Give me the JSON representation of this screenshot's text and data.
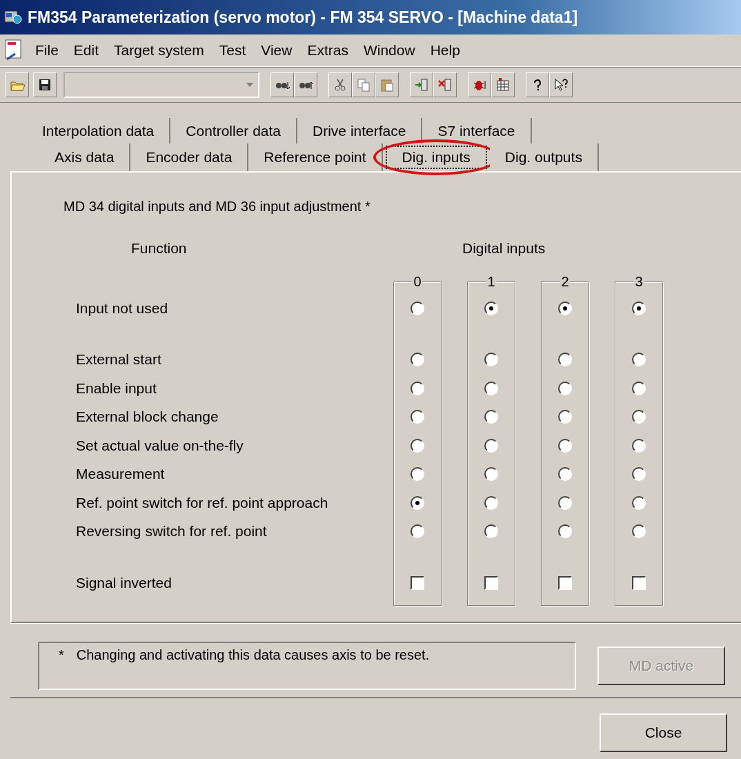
{
  "window": {
    "title": "FM354 Parameterization (servo motor) - FM 354 SERVO - [Machine data1]"
  },
  "menu": [
    "File",
    "Edit",
    "Target system",
    "Test",
    "View",
    "Extras",
    "Window",
    "Help"
  ],
  "tabs_back": [
    {
      "label": "Interpolation data",
      "selected": false
    },
    {
      "label": "Controller data",
      "selected": false
    },
    {
      "label": "Drive interface",
      "selected": false
    },
    {
      "label": "S7 interface",
      "selected": false
    }
  ],
  "tabs_front": [
    {
      "label": "Axis data",
      "selected": false
    },
    {
      "label": "Encoder data",
      "selected": false
    },
    {
      "label": "Reference point",
      "selected": false
    },
    {
      "label": "Dig. inputs",
      "selected": true
    },
    {
      "label": "Dig. outputs",
      "selected": false
    }
  ],
  "heading": "MD 34 digital inputs and MD 36 input adjustment *",
  "function_header": "Function",
  "inputs_header": "Digital inputs",
  "input_columns": [
    "0",
    "1",
    "2",
    "3"
  ],
  "sections": [
    {
      "rows": [
        {
          "label": "Input not used",
          "kind": "radio",
          "inputs": [
            {
              "selected": false
            },
            {
              "selected": true
            },
            {
              "selected": true
            },
            {
              "selected": true
            }
          ]
        }
      ]
    },
    {
      "rows": [
        {
          "label": "External start",
          "kind": "radio",
          "inputs": [
            {
              "selected": false
            },
            {
              "selected": false
            },
            {
              "selected": false
            },
            {
              "selected": false
            }
          ]
        },
        {
          "label": "Enable input",
          "kind": "radio",
          "inputs": [
            {
              "selected": false
            },
            {
              "selected": false
            },
            {
              "selected": false
            },
            {
              "selected": false
            }
          ]
        },
        {
          "label": "External block change",
          "kind": "radio",
          "inputs": [
            {
              "selected": false
            },
            {
              "selected": false
            },
            {
              "selected": false
            },
            {
              "selected": false
            }
          ]
        },
        {
          "label": "Set actual value on-the-fly",
          "kind": "radio",
          "inputs": [
            {
              "selected": false
            },
            {
              "selected": false
            },
            {
              "selected": false
            },
            {
              "selected": false
            }
          ]
        },
        {
          "label": "Measurement",
          "kind": "radio",
          "inputs": [
            {
              "selected": false
            },
            {
              "selected": false
            },
            {
              "selected": false
            },
            {
              "selected": false
            }
          ]
        },
        {
          "label": "Ref. point switch for ref. point approach",
          "kind": "radio",
          "inputs": [
            {
              "selected": true
            },
            {
              "selected": false
            },
            {
              "selected": false
            },
            {
              "selected": false
            }
          ]
        },
        {
          "label": "Reversing switch for ref. point",
          "kind": "radio",
          "inputs": [
            {
              "selected": false
            },
            {
              "selected": false
            },
            {
              "selected": false
            },
            {
              "selected": false
            }
          ]
        }
      ]
    },
    {
      "rows": [
        {
          "label": "Signal inverted",
          "kind": "checkbox",
          "inputs": [
            {
              "checked": false
            },
            {
              "checked": false
            },
            {
              "checked": false
            },
            {
              "checked": false
            }
          ]
        }
      ]
    }
  ],
  "note": {
    "mark": "*",
    "text": "Changing and activating this data causes axis to be reset."
  },
  "md_active_button": {
    "label": "MD active",
    "disabled": true
  },
  "close_button": {
    "label": "Close"
  }
}
